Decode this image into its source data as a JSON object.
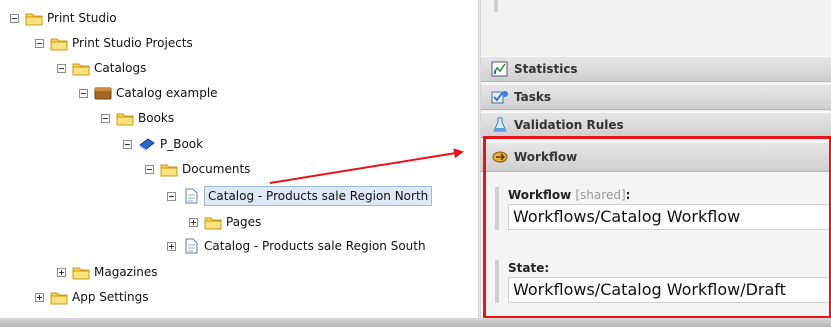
{
  "tree": {
    "nodes": [
      {
        "label": "Print Studio",
        "toggle": "minus",
        "icon": "folder-icon"
      },
      {
        "label": "Print Studio Projects",
        "toggle": "minus",
        "icon": "folder-icon"
      },
      {
        "label": "Catalogs",
        "toggle": "minus",
        "icon": "folder-icon"
      },
      {
        "label": "Catalog example",
        "toggle": "minus",
        "icon": "catalog-icon"
      },
      {
        "label": "Books",
        "toggle": "minus",
        "icon": "folder-icon"
      },
      {
        "label": "P_Book",
        "toggle": "minus",
        "icon": "book-icon"
      },
      {
        "label": "Documents",
        "toggle": "minus",
        "icon": "folder-icon"
      },
      {
        "label": "Catalog - Products sale Region North",
        "toggle": "minus",
        "icon": "document-icon",
        "selected": true
      },
      {
        "label": "Pages",
        "toggle": "plus",
        "icon": "folder-icon"
      },
      {
        "label": "Catalog - Products sale Region South",
        "toggle": "plus",
        "icon": "document-icon"
      },
      {
        "label": "Magazines",
        "toggle": "plus",
        "icon": "folder-icon"
      },
      {
        "label": "App Settings",
        "toggle": "plus",
        "icon": "folder-icon"
      }
    ]
  },
  "panel": {
    "sections": [
      {
        "label": "Statistics",
        "icon": "statistics-icon"
      },
      {
        "label": "Tasks",
        "icon": "tasks-icon"
      },
      {
        "label": "Validation Rules",
        "icon": "validation-rules-icon"
      },
      {
        "label": "Workflow",
        "icon": "workflow-icon"
      }
    ],
    "workflow": {
      "workflow_label": "Workflow",
      "workflow_shared": "[shared]",
      "workflow_colon": ":",
      "workflow_value": "Workflows/Catalog Workflow",
      "state_label": "State:",
      "state_value": "Workflows/Catalog Workflow/Draft"
    }
  },
  "annotation": {
    "highlight_color": "#e8141c",
    "arrow_color": "#e8141c"
  }
}
